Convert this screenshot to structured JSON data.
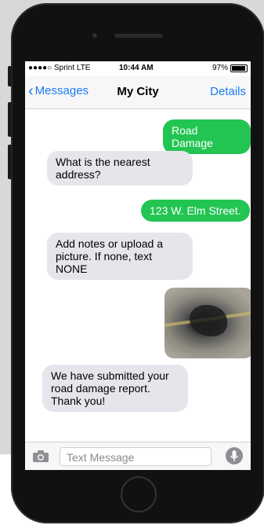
{
  "status_bar": {
    "carrier": "●●●●○ Sprint  LTE",
    "time": "10:44 AM",
    "battery": "97%"
  },
  "nav": {
    "back_label": "Messages",
    "title": "My City",
    "details_label": "Details"
  },
  "messages": [
    {
      "direction": "out",
      "text": "Road Damage"
    },
    {
      "direction": "in",
      "text": "What is the nearest address?"
    },
    {
      "direction": "out",
      "text": "123 W. Elm Street."
    },
    {
      "direction": "in",
      "text": "Add notes or upload a picture. If none, text NONE"
    },
    {
      "direction": "out",
      "type": "photo"
    },
    {
      "direction": "in",
      "text": "We have submitted your road damage report. Thank you!"
    }
  ],
  "composer": {
    "placeholder": "Text Message"
  },
  "colors": {
    "outgoing_bubble": "#23c552",
    "incoming_bubble": "#e6e5eb",
    "accent": "#1a7cf5"
  }
}
